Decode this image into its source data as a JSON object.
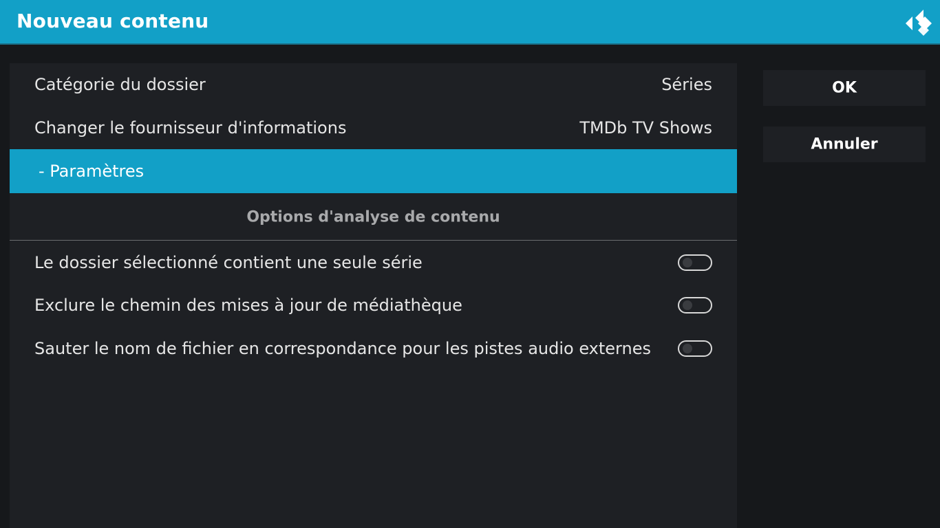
{
  "dialog": {
    "title": "Nouveau contenu",
    "logo_icon": "kodi-logo-icon",
    "accent_color": "#12a0c7"
  },
  "settings": [
    {
      "label": "Catégorie du dossier",
      "value": "Séries"
    },
    {
      "label": "Changer le fournisseur d'informations",
      "value": "TMDb TV Shows"
    },
    {
      "label": "- Paramètres",
      "selected": true
    }
  ],
  "section": {
    "title": "Options d'analyse de contenu"
  },
  "toggles": [
    {
      "label": "Le dossier sélectionné contient une seule série",
      "enabled": false
    },
    {
      "label": "Exclure le chemin des mises à jour de médiathèque",
      "enabled": false
    },
    {
      "label": "Sauter le nom de fichier en correspondance pour les pistes audio externes",
      "enabled": false
    }
  ],
  "buttons": {
    "ok_label": "OK",
    "cancel_label": "Annuler"
  }
}
